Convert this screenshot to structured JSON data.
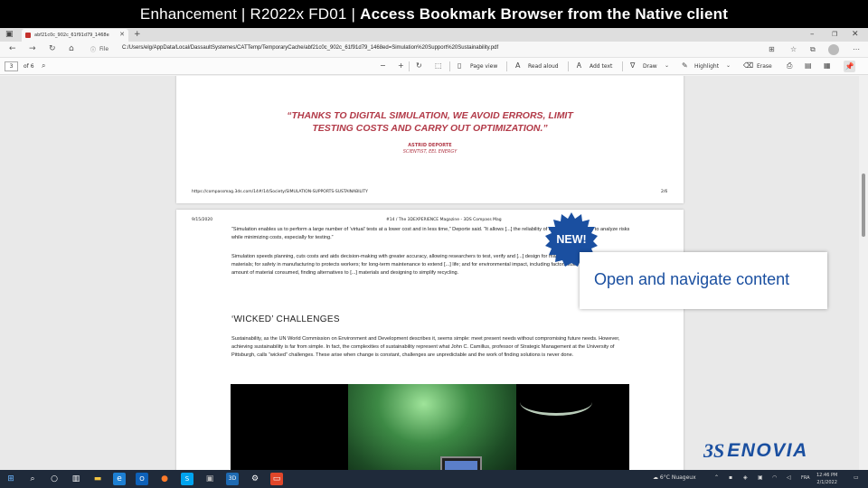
{
  "banner": {
    "prefix": "Enhancement | R2022x FD01 |",
    "title": "Access Bookmark Browser from the Native client"
  },
  "browser": {
    "tab_title": "abf21c0c_902c_61f91d79_1468e",
    "file_label": "File",
    "url": "C:/Users/elg/AppData/Local/DassaultSystemes/CATTemp/TemporaryCache/abf21c0c_902c_61f91d79_1468ed=Simulation%20Support%20Sustainability.pdf"
  },
  "pdf_toolbar": {
    "page_number": "3",
    "page_of": "of 6",
    "page_view": "Page view",
    "read_aloud": "Read aloud",
    "add_text": "Add text",
    "draw": "Draw",
    "highlight": "Highlight",
    "erase": "Erase"
  },
  "page1": {
    "quote_line1": "“THANKS TO DIGITAL SIMULATION, WE AVOID ERRORS, LIMIT",
    "quote_line2": "TESTING COSTS AND CARRY OUT OPTIMIZATION.”",
    "author": "ASTRID DEPORTE",
    "affiliation": "SCIENTIST, EEL ENERGY",
    "footer_url": "https://compassmag.3ds.com/14#/14/Society/SIMULATION-SUPPORTS-SUSTAINABILITY",
    "footer_page": "2/6"
  },
  "page2": {
    "date": "9/15/2020",
    "header_title": "#14 / The 3DEXPERIENCE Magazine - 3DS Compass Mag",
    "para1": "“Simulation enables us to perform a large number of ‘virtual’ tests at a lower cost and in less time,” Deporte said. “It allows [...] the reliability of our tidal turbine and to analyze risks while minimizing costs, especially for testing.”",
    "para2": "Simulation speeds planning, cuts costs and aids decision-making with greater accuracy, allowing researchers to test, verify and [...] design for manufacturability to reduce materials; for safety in manufacturing to protects workers; for long-term maintenance to extend [...] life; and for environmental impact, including factors such as minimizing the total amount of material consumed, finding alternatives to [...] materials and designing to simplify recycling.",
    "heading": "‘WICKED’ CHALLENGES",
    "para3": "Sustainability, as the UN World Commission on Environment and Development describes it, seems simple: meet present needs without compromising future needs. However, achieving sustainability is far from simple. In fact, the complexities of sustainability represent what John C. Camillus, professor of Strategic Management at the University of Pittsburgh, calls “wicked” challenges. These arise when change is constant, challenges are unpredictable and the work of finding solutions is never done."
  },
  "overlay": {
    "badge": "NEW!",
    "callout": "Open and navigate content",
    "logo": "ENOVIA"
  },
  "taskbar": {
    "weather": "6°C  Nuageux",
    "lang": "FRA",
    "time": "12:46 PM",
    "date": "2/1/2022"
  },
  "colors": {
    "accent_blue": "#1a4fa0",
    "quote_red": "#b23a48",
    "banner_bg": "#000000"
  }
}
